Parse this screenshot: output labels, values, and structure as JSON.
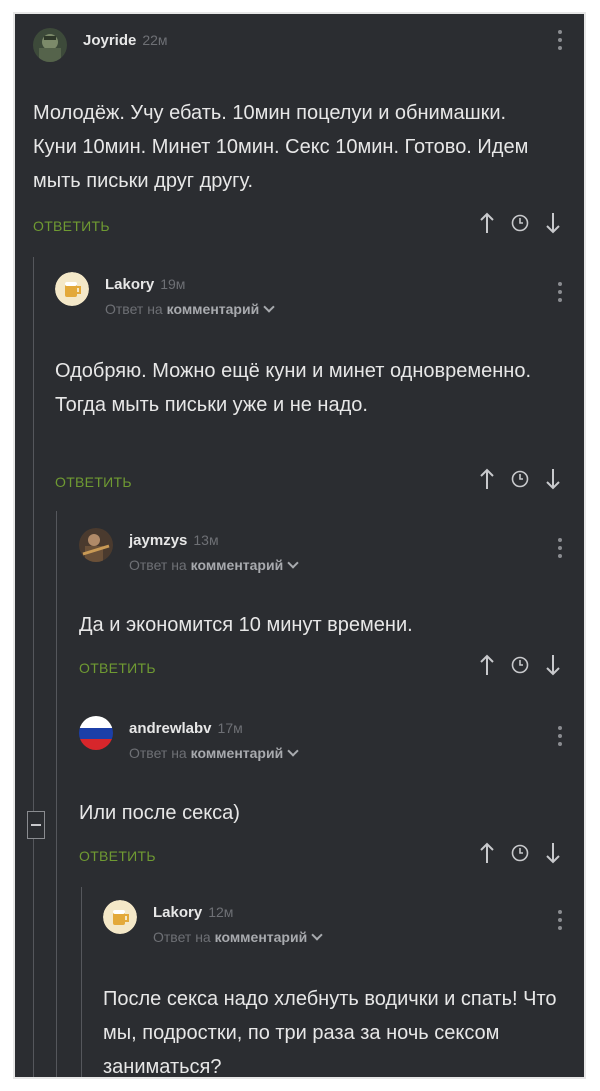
{
  "labels": {
    "reply_to_prefix": "Ответ на",
    "reply_to_link": "комментарий",
    "reply_button": "ОТВЕТИТЬ"
  },
  "colors": {
    "background": "#2b2d31",
    "text": "#e7e7e7",
    "muted": "#6e7075",
    "reply_green": "#6f9a32"
  },
  "comments": [
    {
      "author": "Joyride",
      "time": "22м",
      "avatar": "soldier-avatar",
      "text": "Молодёж. Учу ебать. 10мин поцелуи и обнимашки. Куни 10мин. Минет 10мин. Секс 10мин. Готово. Идем мыть письки друг другу."
    },
    {
      "author": "Lakory",
      "time": "19м",
      "avatar": "beer-avatar",
      "text": "Одобряю. Можно ещё куни и минет одновременно. Тогда мыть письки уже и не надо."
    },
    {
      "author": "jaymzys",
      "time": "13м",
      "avatar": "guitarist-avatar",
      "text": "Да и экономится 10 минут времени."
    },
    {
      "author": "andrewlabv",
      "time": "17м",
      "avatar": "russian-flag-avatar",
      "text": "Или после секса)"
    },
    {
      "author": "Lakory",
      "time": "12м",
      "avatar": "beer-avatar",
      "text": "После секса надо хлебнуть водички и спать! Что мы, подростки, по три раза за ночь сексом заниматься?"
    }
  ]
}
